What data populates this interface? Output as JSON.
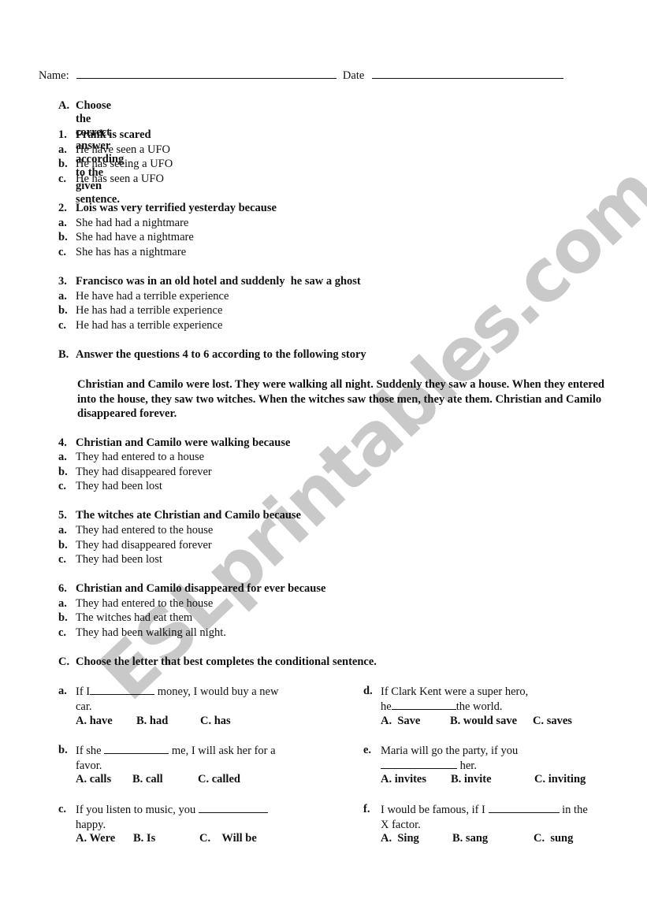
{
  "header": {
    "name_label": "Name:",
    "date_label": "Date"
  },
  "watermark": "ESLprintables.com",
  "section_a": {
    "letter": "A.",
    "title": "Choose the correct answer according to the given sentence.",
    "questions": [
      {
        "num": "1.",
        "text": "Frank is scared",
        "options": [
          {
            "l": "a.",
            "t": "He have seen a UFO"
          },
          {
            "l": "b.",
            "t": "He has seeing a UFO"
          },
          {
            "l": "c.",
            "t": "He has seen a UFO"
          }
        ]
      },
      {
        "num": "2.",
        "text": "Lois was very terrified yesterday because",
        "options": [
          {
            "l": "a.",
            "t": "She had had a nightmare"
          },
          {
            "l": "b.",
            "t": "She had have a nightmare"
          },
          {
            "l": "c.",
            "t": "She has has a nightmare"
          }
        ]
      },
      {
        "num": "3.",
        "text": "Francisco was in an old hotel and suddenly  he saw a ghost",
        "options": [
          {
            "l": "a.",
            "t": "He have had a terrible experience"
          },
          {
            "l": "b.",
            "t": "He has had a terrible experience"
          },
          {
            "l": "c.",
            "t": "He had has a terrible experience"
          }
        ]
      }
    ]
  },
  "section_b": {
    "letter": "B.",
    "title": "Answer the questions 4 to 6 according to the following story",
    "story": "Christian and Camilo were lost. They were walking all night. Suddenly they saw a house. When they entered into the house, they saw two witches. When the witches saw those men, they ate them. Christian and Camilo disappeared forever.",
    "questions": [
      {
        "num": "4.",
        "text": "Christian and Camilo were walking because",
        "options": [
          {
            "l": "a.",
            "t": "They had entered to a house"
          },
          {
            "l": "b.",
            "t": "They had disappeared forever"
          },
          {
            "l": "c.",
            "t": "They had been lost"
          }
        ]
      },
      {
        "num": "5.",
        "text": "The witches ate Christian and Camilo because",
        "options": [
          {
            "l": "a.",
            "t": "They had entered to the house"
          },
          {
            "l": "b.",
            "t": "They had disappeared forever"
          },
          {
            "l": "c.",
            "t": "They had been lost"
          }
        ]
      },
      {
        "num": "6.",
        "text": "Christian and Camilo disappeared for ever because",
        "options": [
          {
            "l": "a.",
            "t": "They had entered to the house"
          },
          {
            "l": "b.",
            "t": "The witches had eat them"
          },
          {
            "l": "c.",
            "t": "They had been walking all night."
          }
        ]
      }
    ]
  },
  "section_c": {
    "letter": "C.",
    "title": "Choose the letter that best completes the conditional sentence.",
    "items": [
      {
        "label": "a.",
        "before": "If I",
        "after": " money, I would buy a new",
        "line2": "car.",
        "options": [
          "A.  have",
          "B.  had",
          "C.   has"
        ]
      },
      {
        "label": "b.",
        "before": "If she ",
        "after": " me, I will ask her for a",
        "line2": "favor.",
        "options": [
          "A.  calls",
          "B. call",
          "C. called"
        ]
      },
      {
        "label": "c.",
        "before": "If you listen to music, you ",
        "after": "",
        "line2": "happy.",
        "options": [
          "A.  Were",
          "B.  Is",
          "C.    Will be"
        ]
      },
      {
        "label": "d.",
        "before": "If Clark Kent were a super hero,",
        "after": "",
        "line2_before": "he",
        "line2_after": "the world.",
        "options": [
          "A.  Save",
          "B. would save",
          "C. saves"
        ]
      },
      {
        "label": "e.",
        "before": "Maria will go the party, if you",
        "after": "",
        "line2_after": " her.",
        "options": [
          "A. invites",
          "B. invite",
          "C. inviting"
        ]
      },
      {
        "label": "f.",
        "before": "I would be famous, if I ",
        "after": " in the",
        "line2": "X factor.",
        "options": [
          "A.  Sing",
          "B. sang",
          "C.  sung"
        ]
      }
    ]
  }
}
